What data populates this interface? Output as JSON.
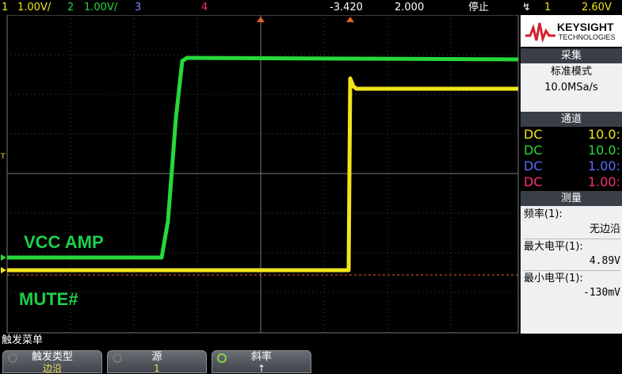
{
  "topbar": {
    "ch1_num": "1",
    "ch1_scale": "1.00V/",
    "ch2_num": "2",
    "ch2_scale": "1.00V/",
    "ch3_num": "3",
    "ch4_num": "4",
    "time_offset": "-3.420",
    "time_scale": "2.000",
    "run_state": "停止",
    "trig_icon": "↯",
    "trig_source": "1",
    "trig_level": "2.60V"
  },
  "colors": {
    "ch1": "#f2e519",
    "ch2": "#27d83a",
    "ch3": "#5a6bff",
    "ch4": "#ff2d7a"
  },
  "annotations": {
    "top": "VCC  AMP",
    "bottom": "MUTE#"
  },
  "panel": {
    "logo_main": "KEYSIGHT",
    "logo_sub": "TECHNOLOGIES",
    "acq_title": "采集",
    "acq_mode": "标准模式",
    "acq_rate": "10.0MSa/s",
    "chan_title": "通道",
    "channels": [
      {
        "coupling": "DC",
        "value": "10.0:"
      },
      {
        "coupling": "DC",
        "value": "10.0:"
      },
      {
        "coupling": "DC",
        "value": "1.00:"
      },
      {
        "coupling": "DC",
        "value": "1.00:"
      }
    ],
    "meas_title": "测量",
    "freq_label": "频率(1):",
    "freq_value": "无边沿",
    "max_label": "最大电平(1):",
    "max_value": "4.89V",
    "min_label": "最小电平(1):",
    "min_value": "-130mV"
  },
  "menu": {
    "title": "触发菜单",
    "keys": [
      {
        "label": "触发类型",
        "value": "边沿"
      },
      {
        "label": "源",
        "value": "1"
      },
      {
        "label": "斜率",
        "value": "↑"
      }
    ]
  }
}
